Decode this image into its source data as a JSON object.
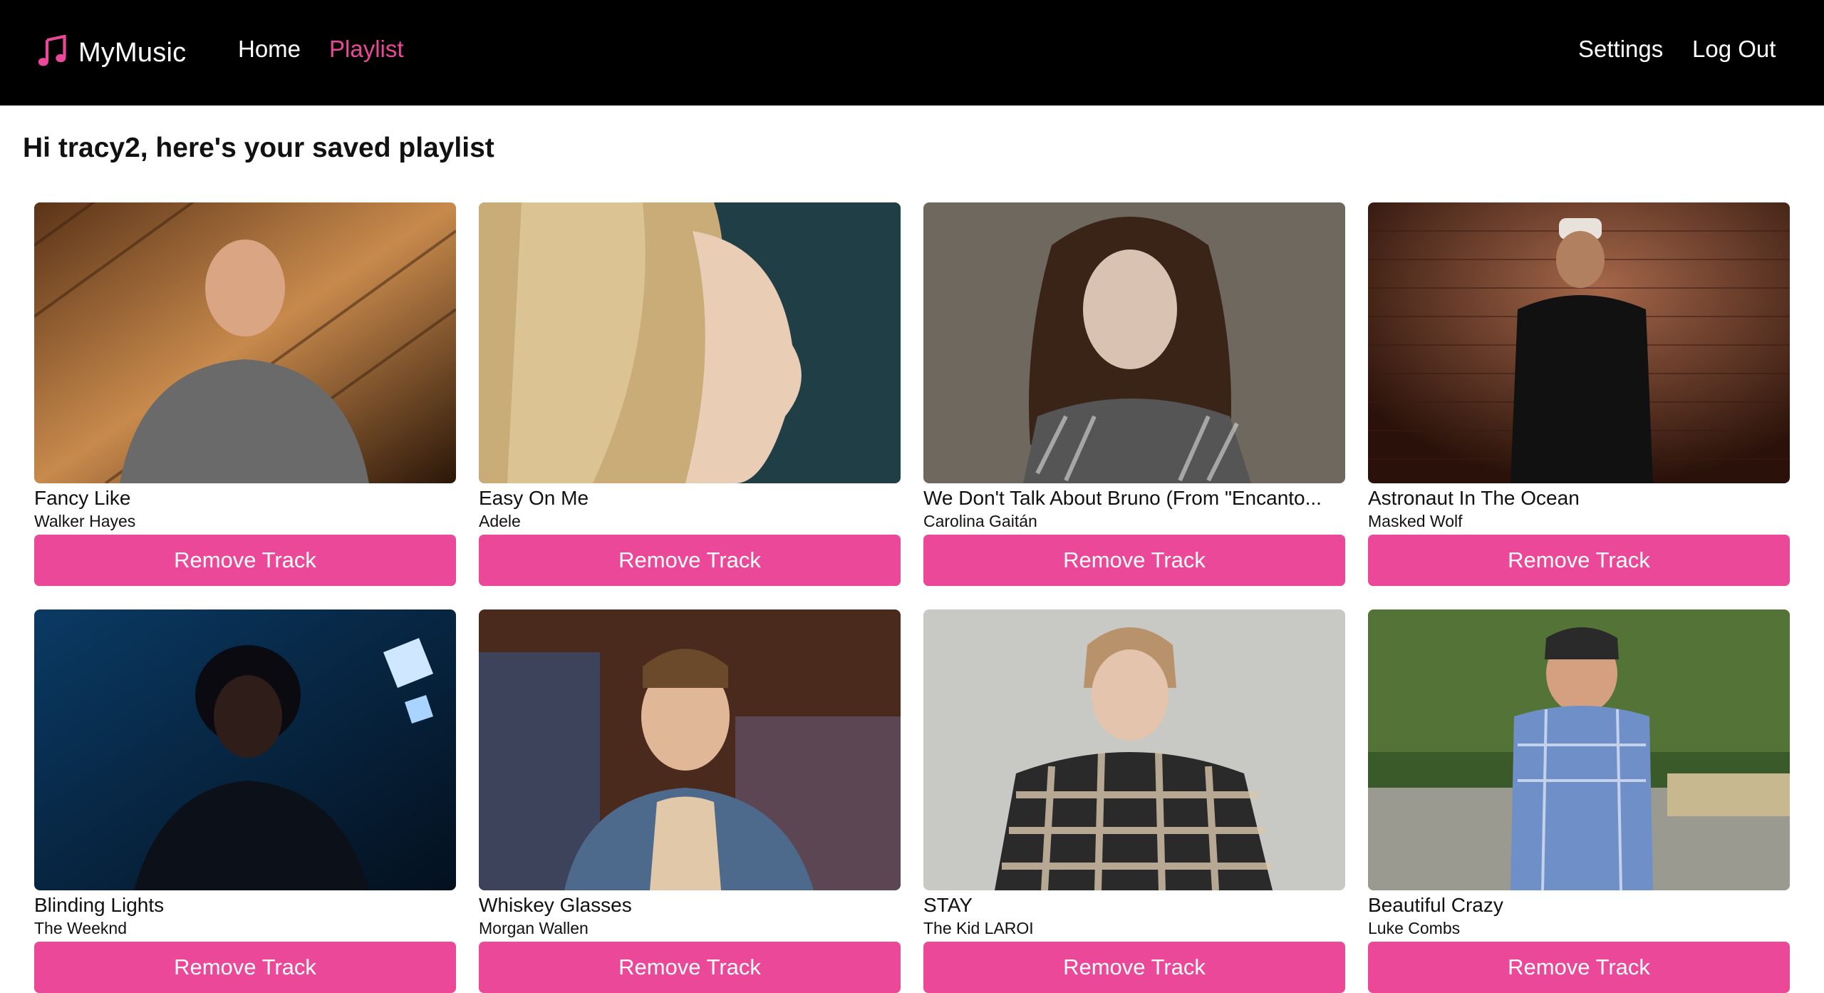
{
  "app": {
    "name": "MyMusic",
    "brand_color": "#ec4899",
    "logo_icon": "music-note-icon"
  },
  "nav": {
    "home": "Home",
    "playlist": "Playlist",
    "settings": "Settings",
    "logout": "Log Out"
  },
  "greeting": "Hi tracy2, here's your saved playlist",
  "tracks": [
    {
      "title": "Fancy Like",
      "artist": "Walker Hayes",
      "button": "Remove Track",
      "art_palette": [
        "#7a4a26",
        "#c88a4c",
        "#2a1a10"
      ]
    },
    {
      "title": "Easy On Me",
      "artist": "Adele",
      "button": "Remove Track",
      "art_palette": [
        "#1f3e45",
        "#d8c08a",
        "#e9cdb5"
      ]
    },
    {
      "title": "We Don't Talk About Bruno (From \"Encanto...",
      "artist": "Carolina Gaitán",
      "button": "Remove Track",
      "art_palette": [
        "#6e685f",
        "#3a2418",
        "#d9c2b2"
      ]
    },
    {
      "title": "Astronaut In The Ocean",
      "artist": "Masked Wolf",
      "button": "Remove Track",
      "art_palette": [
        "#5c3426",
        "#a5674a",
        "#111111"
      ]
    },
    {
      "title": "Blinding Lights",
      "artist": "The Weeknd",
      "button": "Remove Track",
      "art_palette": [
        "#0a2a4a",
        "#1e6aa8",
        "#0a0a14"
      ]
    },
    {
      "title": "Whiskey Glasses",
      "artist": "Morgan Wallen",
      "button": "Remove Track",
      "art_palette": [
        "#4a2a1c",
        "#4d6a8c",
        "#e0c8a8"
      ]
    },
    {
      "title": "STAY",
      "artist": "The Kid LAROI",
      "button": "Remove Track",
      "art_palette": [
        "#c8c8c4",
        "#2a2a2a",
        "#d9c8ae"
      ]
    },
    {
      "title": "Beautiful Crazy",
      "artist": "Luke Combs",
      "button": "Remove Track",
      "art_palette": [
        "#3a5a2a",
        "#6f8fc8",
        "#9a9a90"
      ]
    }
  ]
}
